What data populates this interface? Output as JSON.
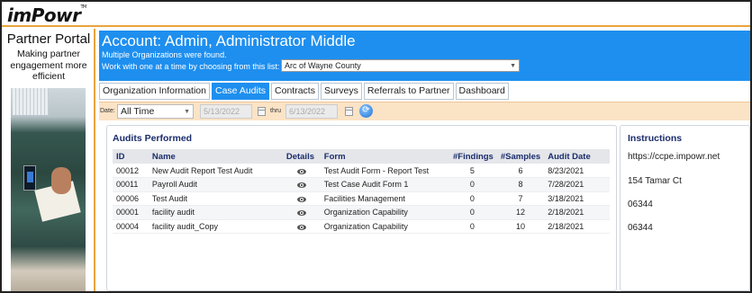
{
  "brand": {
    "logo": "imPowr",
    "tm": "TM"
  },
  "sidebar": {
    "title": "Partner Portal",
    "subtitle": "Making partner engagement more efficient"
  },
  "header": {
    "account": "Account: Admin, Administrator Middle",
    "multi_org": "Multiple Organizations were found.",
    "work_with": "Work with one at a time by choosing from this list:",
    "org_selected": "Arc of Wayne County"
  },
  "tabs": [
    {
      "label": "Organization Information",
      "active": false
    },
    {
      "label": "Case Audits",
      "active": true
    },
    {
      "label": "Contracts",
      "active": false
    },
    {
      "label": "Surveys",
      "active": false
    },
    {
      "label": "Referrals to Partner",
      "active": false
    },
    {
      "label": "Dashboard",
      "active": false
    }
  ],
  "filter": {
    "date_label": "Date:",
    "range": "All Time",
    "from": "5/13/2022",
    "thru_label": "thru",
    "to": "6/13/2022"
  },
  "audits": {
    "title": "Audits Performed",
    "columns": [
      "ID",
      "Name",
      "Details",
      "Form",
      "#Findings",
      "#Samples",
      "Audit Date"
    ],
    "rows": [
      {
        "id": "00012",
        "name": "New Audit Report Test Audit",
        "form": "Test Audit Form - Report Test",
        "findings": "5",
        "samples": "6",
        "date": "8/23/2021"
      },
      {
        "id": "00011",
        "name": "Payroll Audit",
        "form": "Test Case Audit Form 1",
        "findings": "0",
        "samples": "8",
        "date": "7/28/2021"
      },
      {
        "id": "00006",
        "name": "Test Audit",
        "form": "Facilities Management",
        "findings": "0",
        "samples": "7",
        "date": "3/18/2021"
      },
      {
        "id": "00001",
        "name": "facility audit",
        "form": "Organization Capability",
        "findings": "0",
        "samples": "12",
        "date": "2/18/2021"
      },
      {
        "id": "00004",
        "name": "facility audit_Copy",
        "form": "Organization Capability",
        "findings": "0",
        "samples": "10",
        "date": "2/18/2021"
      }
    ]
  },
  "instructions": {
    "title": "Instructions",
    "lines": [
      "https://ccpe.impowr.net",
      "154 Tamar Ct",
      "06344",
      "06344"
    ]
  },
  "colors": {
    "header_blue": "#1e8fef",
    "accent_orange": "#e8a33c",
    "filter_bg": "#fbe3c6",
    "title_navy": "#1a2c6b"
  },
  "icons": {
    "details": "eye-icon",
    "calendar": "calendar-icon",
    "refresh": "refresh-icon",
    "dropdown": "chevron-down-icon"
  }
}
